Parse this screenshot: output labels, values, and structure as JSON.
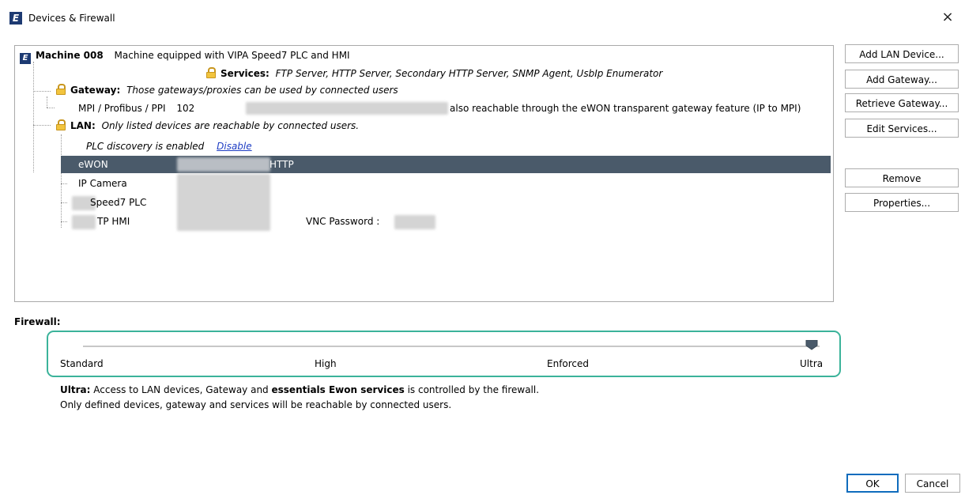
{
  "window": {
    "title": "Devices & Firewall",
    "logo_letter": "E",
    "close_glyph": "×"
  },
  "tree": {
    "machine": {
      "name": "Machine 008",
      "description": "Machine equipped with VIPA Speed7 PLC and HMI"
    },
    "services": {
      "label": "Services:",
      "value": "FTP Server, HTTP Server, Secondary HTTP Server, SNMP Agent, UsbIp Enumerator"
    },
    "gateway": {
      "label": "Gateway:",
      "note": "Those gateways/proxies can be used by connected users",
      "items": [
        {
          "name": "MPI / Profibus / PPI",
          "address": "102",
          "note": "also reachable through the eWON transparent gateway feature (IP to MPI)"
        }
      ]
    },
    "lan": {
      "label": "LAN:",
      "note": "Only listed devices are reachable by connected users.",
      "discovery_text": "PLC discovery is enabled",
      "discovery_link": "Disable",
      "devices": [
        {
          "name": "eWON",
          "extra": "HTTP",
          "selected": true
        },
        {
          "name": "IP Camera",
          "extra": "",
          "selected": false
        },
        {
          "name": "Speed7 PLC",
          "extra": "",
          "selected": false
        },
        {
          "name": "TP HMI",
          "extra": "VNC Password :",
          "selected": false
        }
      ]
    }
  },
  "side_buttons": {
    "add_lan_device": "Add LAN Device...",
    "add_gateway": "Add Gateway...",
    "retrieve_gateway": "Retrieve Gateway...",
    "edit_services": "Edit Services...",
    "remove": "Remove",
    "properties": "Properties..."
  },
  "firewall": {
    "label": "Firewall:",
    "levels": [
      "Standard",
      "High",
      "Enforced",
      "Ultra"
    ],
    "selected_index": 3,
    "accent_color": "#3bb39a",
    "description": {
      "level_name": "Ultra:",
      "line1_a": "Access to LAN devices, Gateway and",
      "line1_bold": "essentials Ewon services",
      "line1_b": "is controlled by the firewall.",
      "line2": "Only defined devices, gateway and services will be reachable by connected users."
    }
  },
  "dialog_buttons": {
    "ok": "OK",
    "cancel": "Cancel"
  },
  "colors": {
    "selection": "#4a5a6a",
    "link": "#1f3ec4",
    "brand": "#1d3a72"
  }
}
